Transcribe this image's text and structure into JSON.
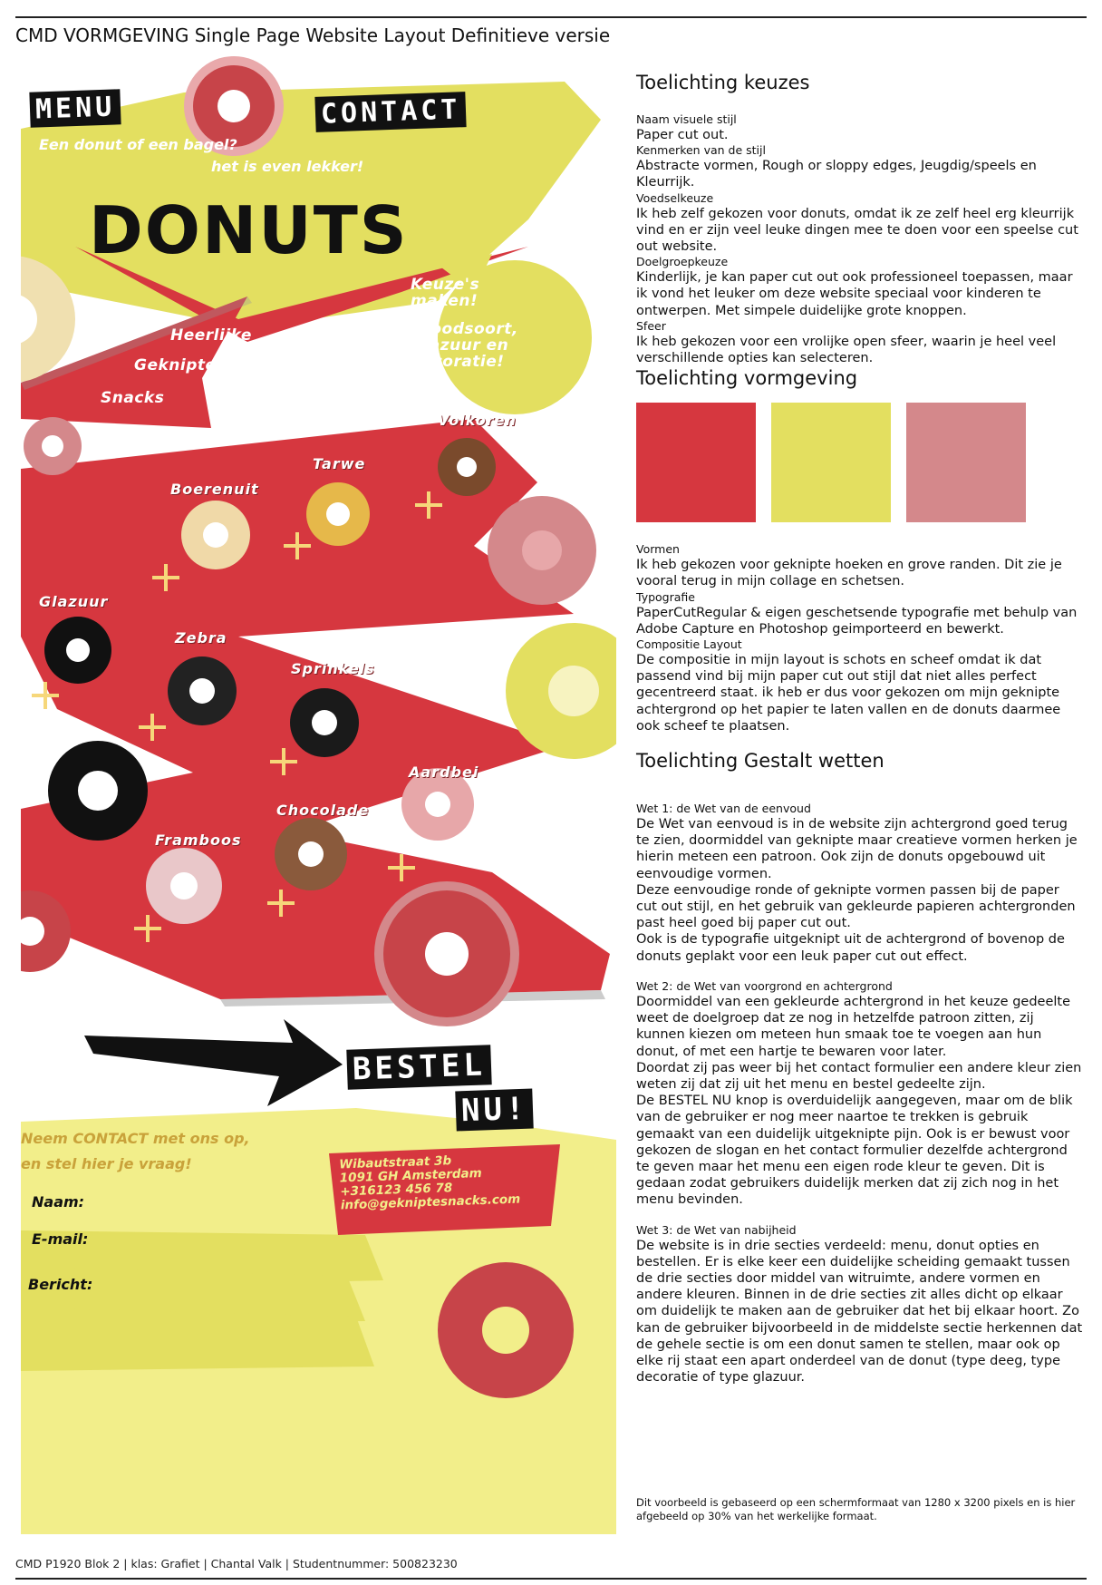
{
  "document": {
    "title": "CMD VORMGEVING Single Page Website Layout Definitieve versie",
    "footer": "CMD P1920 Blok  2 | klas: Grafiet | Chantal Valk | Studentnummer: 500823230",
    "note": "Dit voorbeeld is gebaseerd op een schermformaat van 1280 x 3200 pixels en is hier afgebeeld op 30% van het werkelijke formaat."
  },
  "mockup": {
    "nav": {
      "menu": "MENU",
      "contact": "CONTACT"
    },
    "tagline_1": "Een donut of een bagel?",
    "tagline_2": "het is even lekker!",
    "hero_title": "DONUTS",
    "menu_items": [
      "Heerlijke",
      "Geknipte",
      "Snacks"
    ],
    "bubble_1": "Keuze's maken!",
    "bubble_2": "Broodsoort, Glazuur en decoratie!",
    "flavors": {
      "volkoren": "Volkoren",
      "tarwe": "Tarwe",
      "boerenuit": "Boerenuit",
      "glazuur": "Glazuur",
      "zebra": "Zebra",
      "sprinkels": "Sprinkels",
      "aardbei": "Aardbei",
      "chocolade": "Chocolade",
      "framboos": "Framboos"
    },
    "cta_line_1": "BESTEL",
    "cta_line_2": "NU!",
    "contact_line_1": "Neem CONTACT met ons op,",
    "contact_line_2": "en stel hier je vraag!",
    "form": {
      "naam": "Naam:",
      "email": "E-mail:",
      "bericht": "Bericht:"
    },
    "address": {
      "street": "Wibautstraat 3b",
      "city": "1091 GH Amsterdam",
      "phone": "+316123 456 78",
      "email": "info@gekniptesnacks.com"
    }
  },
  "explain": {
    "h_keuzes": "Toelichting keuzes",
    "s1_label": "Naam visuele stijl",
    "s1_text": "Paper cut out.",
    "s2_label": "Kenmerken van de stijl",
    "s2_text": "Abstracte vormen, Rough or sloppy edges, Jeugdig/speels en Kleurrijk.",
    "s3_label": "Voedselkeuze",
    "s3_text": "Ik heb zelf gekozen voor donuts, omdat ik ze zelf heel erg kleurrijk vind en er zijn veel leuke dingen mee te doen voor een speelse cut out website.",
    "s4_label": "Doelgroepkeuze",
    "s4_text": "Kinderlijk, je kan paper cut out ook professioneel toepassen, maar ik vond het leuker om deze website speciaal voor kinderen te ontwerpen. Met simpele duidelijke grote knoppen.",
    "s5_label": "Sfeer",
    "s5_text": "Ik heb gekozen voor een vrolijke open sfeer, waarin je heel veel verschillende opties kan selecteren.",
    "h_vormgeving": "Toelichting vormgeving",
    "colors": {
      "red": "#d6373f",
      "yellow": "#e3df60",
      "pink": "#d4888b"
    },
    "v1_label": "Vormen",
    "v1_text": "Ik heb gekozen voor geknipte hoeken en grove randen. Dit zie je vooral terug in mijn collage en schetsen.",
    "v2_label": "Typografie",
    "v2_text": "PaperCutRegular & eigen geschetsende typografie met behulp van Adobe Capture en Photoshop geimporteerd en bewerkt.",
    "v3_label": "Compositie Layout",
    "v3_text": "De compositie in mijn layout is schots en scheef omdat ik dat passend vind bij mijn paper cut out stijl dat niet alles perfect gecentreerd staat. ik heb er dus voor gekozen om mijn geknipte achtergrond op het papier te laten vallen en de donuts daarmee ook scheef te plaatsen.",
    "h_gestalt": "Toelichting Gestalt wetten",
    "w1_label": "Wet 1: de Wet van de eenvoud",
    "w1_p1": "De Wet van eenvoud is in de website zijn achtergrond goed terug te zien, doormiddel van geknipte maar creatieve vormen herken je hierin meteen een patroon. Ook zijn de donuts opgebouwd uit eenvoudige vormen.",
    "w1_p2": "Deze eenvoudige ronde of geknipte vormen passen bij de paper cut out stijl, en het gebruik van gekleurde papieren achtergronden past heel goed bij paper cut out.",
    "w1_p3": "Ook is de typografie uitgeknipt uit de achtergrond of bovenop de donuts geplakt voor een leuk paper cut out effect.",
    "w2_label": "Wet 2: de Wet van voorgrond en achtergrond",
    "w2_p1": "Doormiddel van een gekleurde achtergrond in het keuze gedeelte weet de doelgroep dat ze nog in hetzelfde patroon zitten, zij kunnen kiezen om meteen hun smaak toe te voegen aan hun donut, of met een hartje te bewaren voor later.",
    "w2_p2": "Doordat zij pas weer bij het contact formulier een andere kleur zien weten zij dat zij uit het menu en bestel gedeelte zijn.",
    "w2_p3": "De BESTEL NU knop is overduidelijk aangegeven, maar om de blik van de gebruiker er nog meer naartoe te trekken is gebruik gemaakt van een duidelijk uitgeknipte pijn. Ook is er bewust voor gekozen de slogan en het contact formulier dezelfde achtergrond te geven maar het menu een eigen rode kleur te geven. Dit is gedaan zodat gebruikers duidelijk merken dat zij zich nog in het menu bevinden.",
    "w3_label": "Wet 3: de Wet van nabijheid",
    "w3_p1": "De website is in drie secties verdeeld: menu, donut opties en bestellen. Er is elke keer een duidelijke scheiding gemaakt tussen de drie secties door middel van witruimte, andere vormen en andere kleuren. Binnen in de drie secties zit alles dicht op elkaar om duidelijk te maken aan de gebruiker dat het bij elkaar hoort. Zo kan de gebruiker bijvoorbeeld in de middelste sectie herkennen dat de gehele sectie is om een donut samen te stellen, maar ook op elke rij staat een apart onderdeel van de donut (type deeg, type decoratie of type glazuur."
  }
}
